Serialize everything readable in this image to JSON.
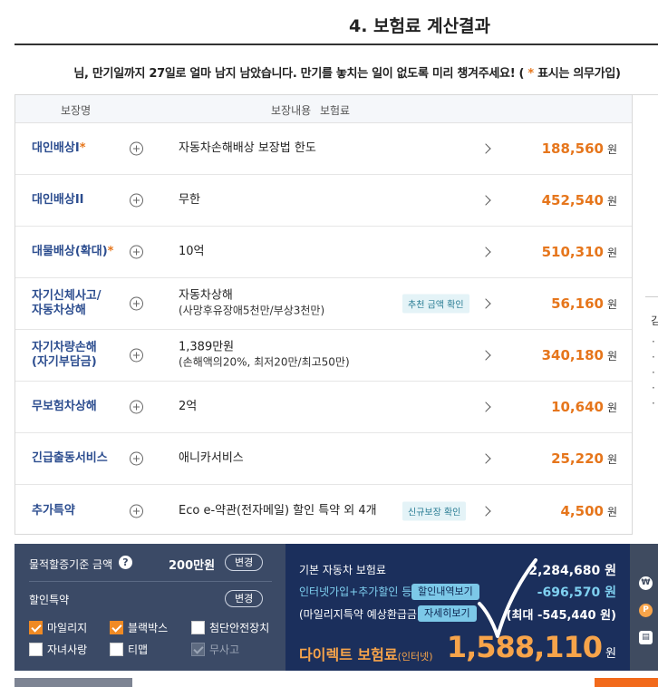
{
  "header": {
    "title": "4. 보험료 계산결과",
    "notice_before": "님, 만기일까지 27일로 얼마 남지 남았습니다. 만기를 놓치는 일이 없도록 미리 챙겨주세요! ( ",
    "notice_star": "*",
    "notice_after": " 표시는 의무가입)"
  },
  "table": {
    "col_name": "보장명",
    "col_detail": "보장내용 보험료",
    "currency": "원",
    "rows": [
      {
        "name": "대인배상I",
        "required": "*",
        "desc": "자동차손해배상 보장법 한도",
        "desc2": "",
        "tag": "",
        "amount": "188,560"
      },
      {
        "name": "대인배상II",
        "required": "",
        "desc": "무한",
        "desc2": "",
        "tag": "",
        "amount": "452,540"
      },
      {
        "name": "대물배상(확대)",
        "required": "*",
        "desc": "10억",
        "desc2": "",
        "tag": "",
        "amount": "510,310"
      },
      {
        "name": "자기신체사고/\n자동차상해",
        "required": "",
        "desc": "자동차상해",
        "desc2": "(사망후유장애5천만/부상3천만)",
        "tag": "추천 금액 확인",
        "amount": "56,160"
      },
      {
        "name": "자기차량손해\n(자기부담금)",
        "required": "",
        "desc": "1,389만원",
        "desc2": "(손해액의20%, 최저20만/최고50만)",
        "tag": "",
        "amount": "340,180"
      },
      {
        "name": "무보험차상해",
        "required": "",
        "desc": "2억",
        "desc2": "",
        "tag": "",
        "amount": "10,640"
      },
      {
        "name": "긴급출동서비스",
        "required": "",
        "desc": "애니카서비스",
        "desc2": "",
        "tag": "",
        "amount": "25,220"
      },
      {
        "name": "추가특약",
        "required": "",
        "desc": "Eco e-약관(전자메일) 할인 특약 외 4개",
        "desc2": "",
        "tag": "신규보장 확인",
        "amount": "4,500"
      }
    ]
  },
  "side_panel": {
    "heading": "김"
  },
  "summary": {
    "property_label": "물적할증기준 금액",
    "help_icon": "question-icon",
    "property_value": "200만원",
    "change_label": "변경",
    "discount_label": "할인특약",
    "checkboxes": [
      {
        "label": "마일리지",
        "checked": true,
        "disabled": false
      },
      {
        "label": "블랙박스",
        "checked": true,
        "disabled": false
      },
      {
        "label": "첨단안전장치",
        "checked": false,
        "disabled": false
      },
      {
        "label": "자녀사랑",
        "checked": false,
        "disabled": false
      },
      {
        "label": "티맵",
        "checked": false,
        "disabled": false
      },
      {
        "label": "무사고",
        "checked": true,
        "disabled": true
      }
    ],
    "base_label": "기본 자동차 보험료",
    "base_value": "2,284,680 원",
    "discount_line_label": "인터넷가입+추가할인 등",
    "discount_detail_button": "할인내역보기",
    "discount_value": "-696,570 원",
    "mileage_label": "(마일리지특약 예상환급금)",
    "mileage_detail_button": "자세히보기",
    "mileage_value": "(최대 -545,440 원)",
    "direct_label": "다이렉트 보험료",
    "direct_sub": "(인터넷)",
    "direct_value": "1,588,110",
    "direct_currency": "원"
  },
  "colors": {
    "accent": "#e6761c",
    "navy": "#1b2f5c",
    "label_blue": "#2c4d8f"
  }
}
